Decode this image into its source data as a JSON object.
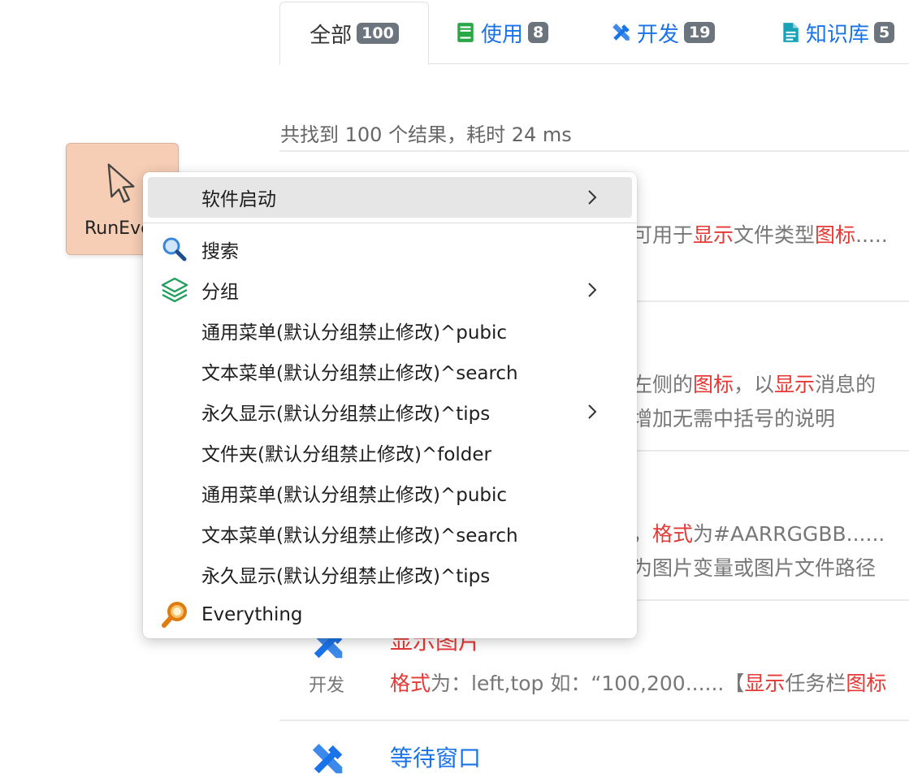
{
  "tabs": [
    {
      "label": "全部",
      "count": "100",
      "icon": "none",
      "active": true
    },
    {
      "label": "使用",
      "count": "8",
      "icon": "book-icon"
    },
    {
      "label": "开发",
      "count": "19",
      "icon": "tools-icon"
    },
    {
      "label": "知识库",
      "count": "5",
      "icon": "document-icon"
    }
  ],
  "summary": "共找到 100 个结果，耗时 24 ms",
  "results": {
    "r1": {
      "pre": "可用于",
      "h1": "显示",
      "mid": "文件类型",
      "h2": "图标",
      "post": "....."
    },
    "r2": {
      "line1": {
        "pre": "左侧的",
        "h1": "图标",
        "mid": "，以",
        "h2": "显示",
        "post": "消息的"
      },
      "line2": "增加无需中括号的说明"
    },
    "r3": {
      "line1": {
        "pre": "，",
        "h1": "格式",
        "post": "为#AARRGGBB......"
      },
      "line2": "为图片变量或图片文件路径"
    },
    "r4": {
      "title": "显示图片",
      "category": "开发",
      "snippet": {
        "h1": "格式",
        "mid": "为：left,top   如：“100,200......【",
        "h2": "显示",
        "mid2": "任务栏",
        "h3": "图标"
      }
    },
    "r5": {
      "title": "等待窗口"
    }
  },
  "tile": {
    "label": "RunEverything",
    "icon": "cursor-icon"
  },
  "menu": {
    "items": [
      {
        "label": "软件启动",
        "icon": "none",
        "submenu": true,
        "highlighted": true
      },
      {
        "label": "搜索",
        "icon": "magnifier-icon",
        "submenu": false
      },
      {
        "label": "分组",
        "icon": "layers-icon",
        "submenu": true
      },
      {
        "label": "通用菜单(默认分组禁止修改)^pubic",
        "icon": "none",
        "submenu": false
      },
      {
        "label": "文本菜单(默认分组禁止修改)^search",
        "icon": "none",
        "submenu": false
      },
      {
        "label": "永久显示(默认分组禁止修改)^tips",
        "icon": "none",
        "submenu": true
      },
      {
        "label": "文件夹(默认分组禁止修改)^folder",
        "icon": "none",
        "submenu": false
      },
      {
        "label": "通用菜单(默认分组禁止修改)^pubic",
        "icon": "none",
        "submenu": false
      },
      {
        "label": "文本菜单(默认分组禁止修改)^search",
        "icon": "none",
        "submenu": false
      },
      {
        "label": "永久显示(默认分组禁止修改)^tips",
        "icon": "none",
        "submenu": false
      },
      {
        "label": "Everything",
        "icon": "everything-search-icon",
        "submenu": false
      }
    ]
  },
  "colors": {
    "accent": "#1a73e8",
    "highlight": "#e53935",
    "badge": "#6c757d",
    "tile": "#f6cdb5"
  }
}
